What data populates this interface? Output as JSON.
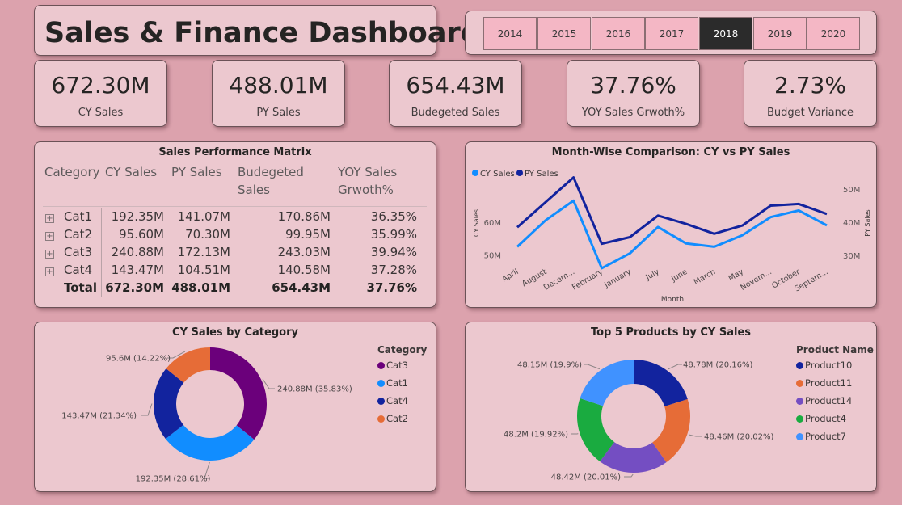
{
  "title": "Sales & Finance Dashboard",
  "years": [
    "2014",
    "2015",
    "2016",
    "2017",
    "2018",
    "2019",
    "2020"
  ],
  "selected_year": "2018",
  "kpis": [
    {
      "value": "672.30M",
      "label": "CY Sales"
    },
    {
      "value": "488.01M",
      "label": "PY Sales"
    },
    {
      "value": "654.43M",
      "label": "Budegeted Sales"
    },
    {
      "value": "37.76%",
      "label": "YOY Sales Grwoth%"
    },
    {
      "value": "2.73%",
      "label": "Budget Variance"
    }
  ],
  "matrix": {
    "title": "Sales Performance Matrix",
    "headers": [
      "Category",
      "CY Sales",
      "PY Sales",
      "Budegeted",
      "Sales",
      "YOY Sales",
      "Grwoth%"
    ],
    "rows": [
      {
        "category": "Cat1",
        "cy": "192.35M",
        "py": "141.07M",
        "budget": "170.86M",
        "yoy": "36.35%"
      },
      {
        "category": "Cat2",
        "cy": "95.60M",
        "py": "70.30M",
        "budget": "99.95M",
        "yoy": "35.99%"
      },
      {
        "category": "Cat3",
        "cy": "240.88M",
        "py": "172.13M",
        "budget": "243.03M",
        "yoy": "39.94%"
      },
      {
        "category": "Cat4",
        "cy": "143.47M",
        "py": "104.51M",
        "budget": "140.58M",
        "yoy": "37.28%"
      }
    ],
    "total": {
      "category": "Total",
      "cy": "672.30M",
      "py": "488.01M",
      "budget": "654.43M",
      "yoy": "37.76%"
    }
  },
  "colors": {
    "cy": "#118dff",
    "py": "#12239e",
    "cat3": "#6b007b",
    "cat1": "#118dff",
    "cat4": "#12239e",
    "cat2": "#e66c37",
    "product10": "#12239e",
    "product11": "#e66c37",
    "product14": "#744ec2",
    "product4": "#1aab40",
    "product7": "#4092ff"
  },
  "chart_data": [
    {
      "type": "line",
      "title": "Month-Wise Comparison: CY vs PY Sales",
      "xlabel": "Month",
      "ylabel": "CY Sales",
      "y2label": "PY Sales",
      "categories": [
        "April",
        "August",
        "Decem...",
        "February",
        "January",
        "July",
        "June",
        "March",
        "May",
        "Novem...",
        "October",
        "Septem..."
      ],
      "series": [
        {
          "name": "CY Sales",
          "axis": "left",
          "values": [
            52.5,
            60.5,
            66.5,
            46.0,
            50.5,
            58.5,
            53.5,
            52.5,
            56.0,
            61.5,
            63.5,
            59.0
          ]
        },
        {
          "name": "PY Sales",
          "axis": "right",
          "values": [
            38.5,
            46.0,
            53.5,
            33.5,
            35.5,
            42.0,
            39.5,
            36.5,
            39.0,
            45.0,
            45.5,
            42.5
          ]
        }
      ],
      "y_ticks": [
        "50M",
        "60M"
      ],
      "y_range": [
        45,
        70
      ],
      "y2_ticks": [
        "30M",
        "40M",
        "50M"
      ],
      "y2_range": [
        25,
        55
      ],
      "legend": "top-left"
    },
    {
      "type": "pie",
      "title": "CY Sales by Category",
      "legend_title": "Category",
      "legend": [
        "Cat3",
        "Cat1",
        "Cat4",
        "Cat2"
      ],
      "slices": [
        {
          "name": "Cat3",
          "value": 240.88,
          "label": "240.88M (35.83%)"
        },
        {
          "name": "Cat1",
          "value": 192.35,
          "label": "192.35M (28.61%)"
        },
        {
          "name": "Cat4",
          "value": 143.47,
          "label": "143.47M (21.34%)"
        },
        {
          "name": "Cat2",
          "value": 95.6,
          "label": "95.6M (14.22%)"
        }
      ]
    },
    {
      "type": "pie",
      "title": "Top 5 Products by CY Sales",
      "legend_title": "Product Name",
      "legend": [
        "Product10",
        "Product11",
        "Product14",
        "Product4",
        "Product7"
      ],
      "slices": [
        {
          "name": "Product10",
          "value": 48.78,
          "label": "48.78M (20.16%)"
        },
        {
          "name": "Product11",
          "value": 48.46,
          "label": "48.46M (20.02%)"
        },
        {
          "name": "Product14",
          "value": 48.42,
          "label": "48.42M (20.01%)"
        },
        {
          "name": "Product4",
          "value": 48.2,
          "label": "48.2M (19.92%)"
        },
        {
          "name": "Product7",
          "value": 48.15,
          "label": "48.15M (19.9%)"
        }
      ]
    }
  ]
}
